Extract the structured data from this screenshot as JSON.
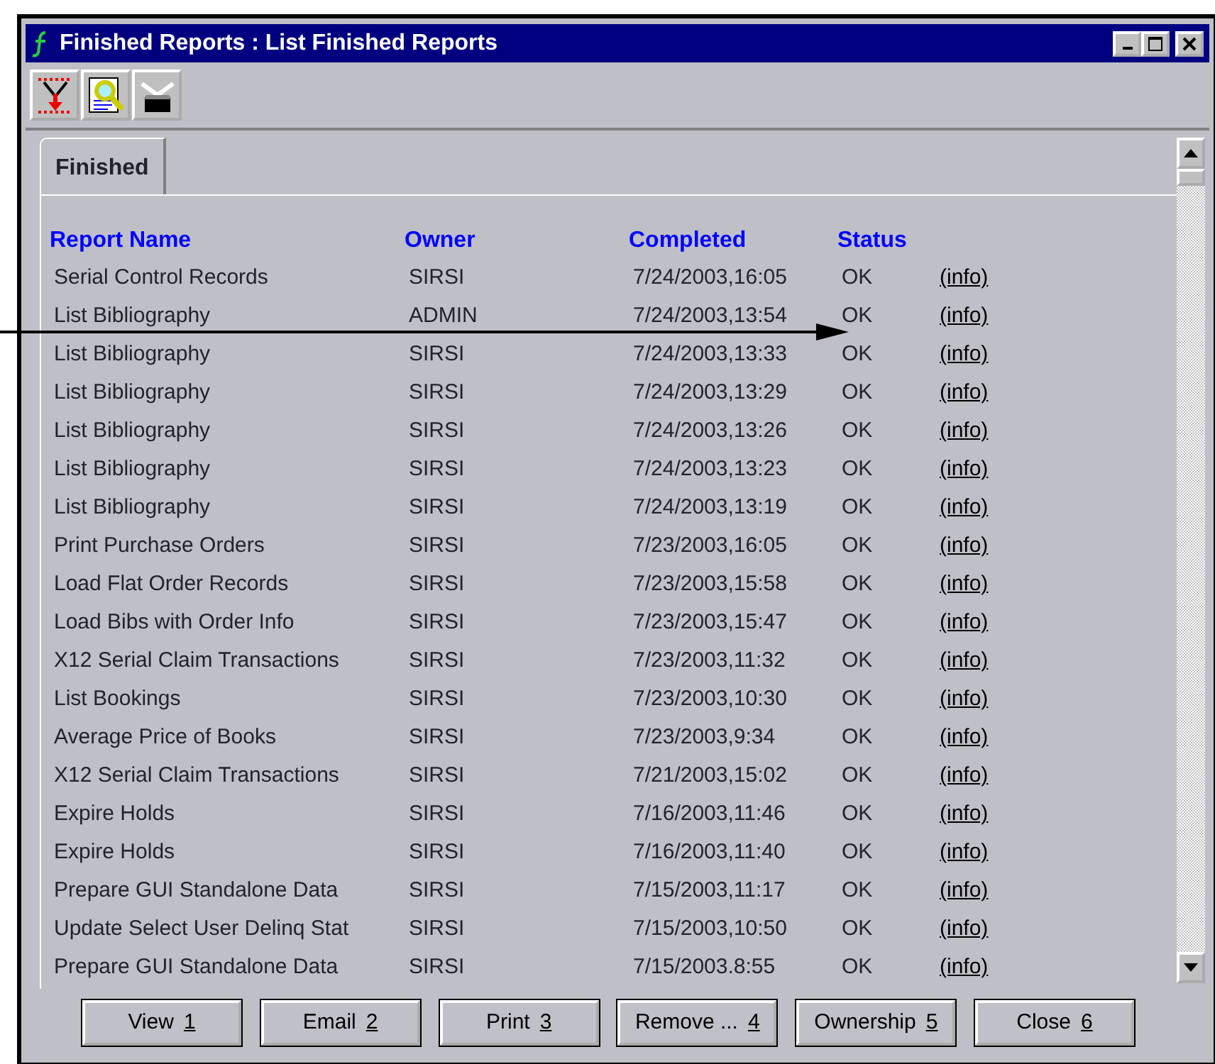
{
  "window": {
    "title": "Finished Reports : List Finished Reports"
  },
  "toolbar": [
    {
      "kind": "funnel"
    },
    {
      "kind": "magnifier"
    },
    {
      "kind": "tray"
    }
  ],
  "tabs": [
    {
      "label": "Finished",
      "selected": true
    }
  ],
  "table": {
    "columns": [
      "Report Name",
      "Owner",
      "Completed",
      "Status"
    ],
    "rows": [
      {
        "name": "Serial Control Records",
        "owner": "SIRSI",
        "completed": "7/24/2003,16:05",
        "status": "OK",
        "link": "(info)"
      },
      {
        "name": "List Bibliography",
        "owner": "ADMIN",
        "completed": "7/24/2003,13:54",
        "status": "OK",
        "link": "(info)"
      },
      {
        "name": "List Bibliography",
        "owner": "SIRSI",
        "completed": "7/24/2003,13:33",
        "status": "OK",
        "link": "(info)"
      },
      {
        "name": "List Bibliography",
        "owner": "SIRSI",
        "completed": "7/24/2003,13:29",
        "status": "OK",
        "link": "(info)"
      },
      {
        "name": "List Bibliography",
        "owner": "SIRSI",
        "completed": "7/24/2003,13:26",
        "status": "OK",
        "link": "(info)"
      },
      {
        "name": "List Bibliography",
        "owner": "SIRSI",
        "completed": "7/24/2003,13:23",
        "status": "OK",
        "link": "(info)"
      },
      {
        "name": "List Bibliography",
        "owner": "SIRSI",
        "completed": "7/24/2003,13:19",
        "status": "OK",
        "link": "(info)"
      },
      {
        "name": "Print Purchase Orders",
        "owner": "SIRSI",
        "completed": "7/23/2003,16:05",
        "status": "OK",
        "link": "(info)"
      },
      {
        "name": "Load Flat Order Records",
        "owner": "SIRSI",
        "completed": "7/23/2003,15:58",
        "status": "OK",
        "link": "(info)"
      },
      {
        "name": "Load Bibs with Order Info",
        "owner": "SIRSI",
        "completed": "7/23/2003,15:47",
        "status": "OK",
        "link": "(info)"
      },
      {
        "name": "X12 Serial Claim Transactions",
        "owner": "SIRSI",
        "completed": "7/23/2003,11:32",
        "status": "OK",
        "link": "(info)"
      },
      {
        "name": "List Bookings",
        "owner": "SIRSI",
        "completed": "7/23/2003,10:30",
        "status": "OK",
        "link": "(info)"
      },
      {
        "name": "Average Price of Books",
        "owner": "SIRSI",
        "completed": "7/23/2003,9:34",
        "status": "OK",
        "link": "(info)"
      },
      {
        "name": "X12 Serial Claim Transactions",
        "owner": "SIRSI",
        "completed": "7/21/2003,15:02",
        "status": "OK",
        "link": "(info)"
      },
      {
        "name": "Expire Holds",
        "owner": "SIRSI",
        "completed": "7/16/2003,11:46",
        "status": "OK",
        "link": "(info)"
      },
      {
        "name": "Expire Holds",
        "owner": "SIRSI",
        "completed": "7/16/2003,11:40",
        "status": "OK",
        "link": "(info)"
      },
      {
        "name": "Prepare GUI Standalone Data",
        "owner": "SIRSI",
        "completed": "7/15/2003,11:17",
        "status": "OK",
        "link": "(info)"
      },
      {
        "name": "Update Select User Delinq Stat",
        "owner": "SIRSI",
        "completed": "7/15/2003,10:50",
        "status": "OK",
        "link": "(info)"
      },
      {
        "name": "Prepare GUI Standalone Data",
        "owner": "SIRSI",
        "completed": "7/15/2003.8:55",
        "status": "OK",
        "link": "(info)"
      }
    ]
  },
  "buttons": [
    {
      "label": "View",
      "key": "1"
    },
    {
      "label": "Email",
      "key": "2"
    },
    {
      "label": "Print",
      "key": "3"
    },
    {
      "label": "Remove ...",
      "key": "4"
    },
    {
      "label": "Ownership",
      "key": "5"
    },
    {
      "label": "Close",
      "key": "6"
    }
  ]
}
